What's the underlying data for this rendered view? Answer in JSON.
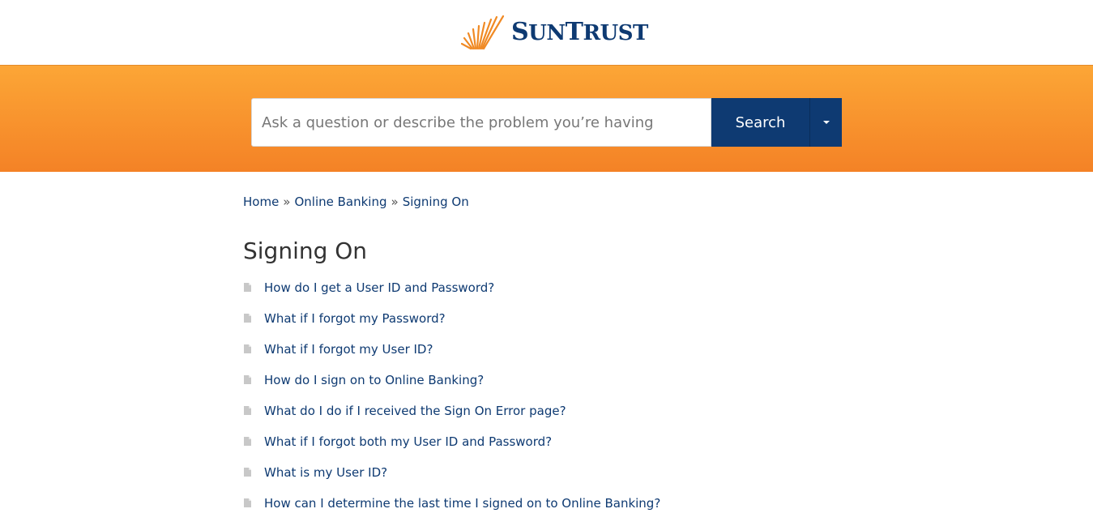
{
  "header": {
    "logo_text_first": "S",
    "logo_text_rest": "UN",
    "logo_text_second": "T",
    "logo_text_second_rest": "RUST"
  },
  "search": {
    "placeholder": "Ask a question or describe the problem you’re having",
    "button_label": "Search",
    "dropdown_icon": "caret-down-icon"
  },
  "breadcrumb": {
    "items": [
      "Home",
      "Online Banking",
      "Signing On"
    ],
    "separator": "»"
  },
  "page": {
    "title": "Signing On"
  },
  "articles": [
    {
      "title": "How do I get a User ID and Password?"
    },
    {
      "title": "What if I forgot my Password?"
    },
    {
      "title": "What if I forgot my User ID?"
    },
    {
      "title": "How do I sign on to Online Banking?"
    },
    {
      "title": "What do I do if I received the Sign On Error page?"
    },
    {
      "title": "What if I forgot both my User ID and Password?"
    },
    {
      "title": "What is my User ID?"
    },
    {
      "title": "How can I determine the last time I signed on to Online Banking?"
    }
  ],
  "colors": {
    "brand_navy": "#0e3a72",
    "banner_top": "#fca636",
    "banner_bottom": "#f48226",
    "sunburst": "#f08a24"
  }
}
